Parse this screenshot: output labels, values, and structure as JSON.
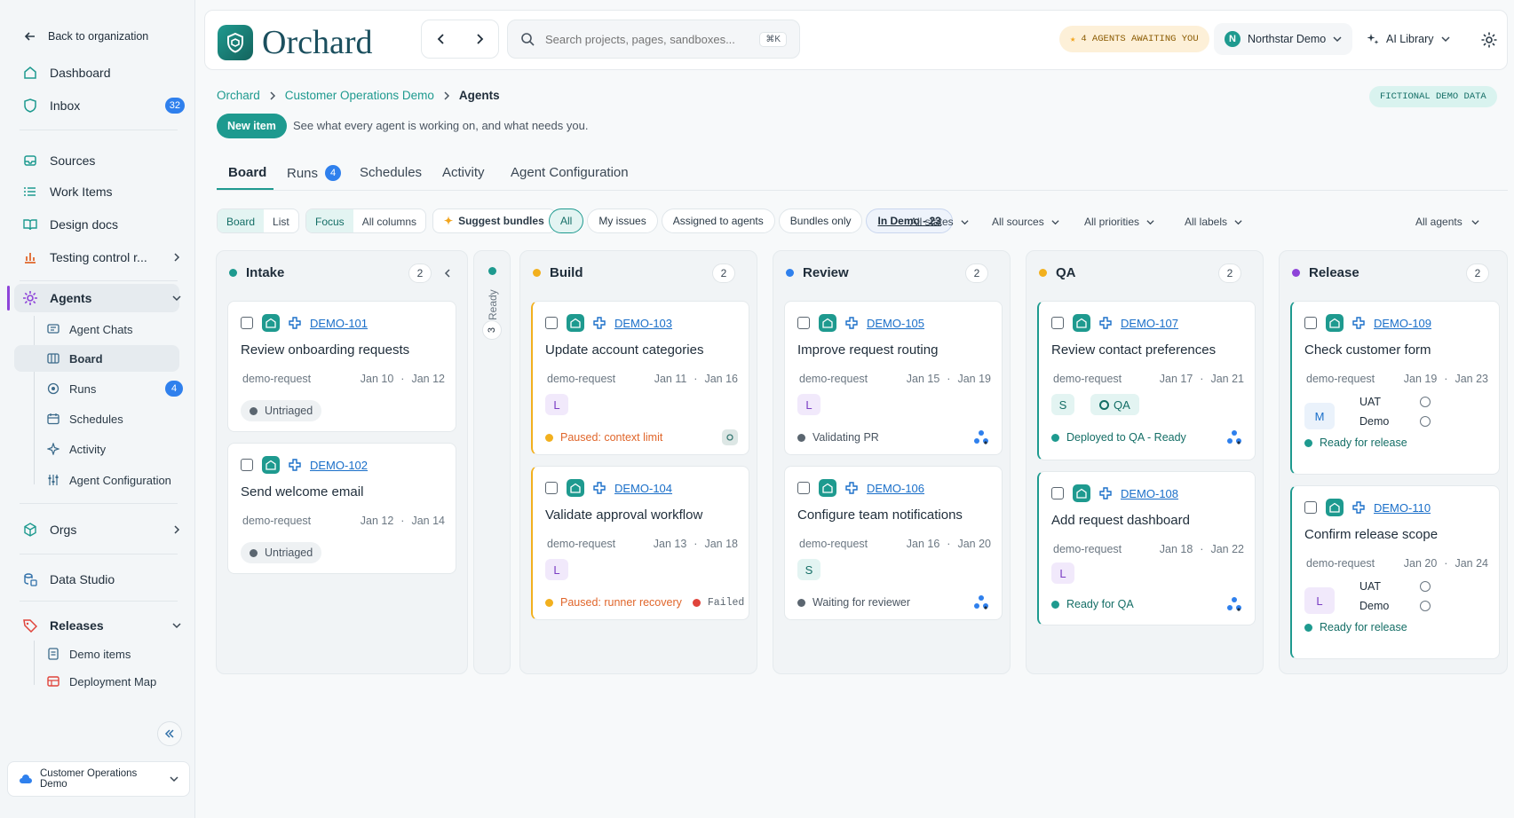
{
  "sidebar": {
    "back": "Back to organization",
    "items": {
      "dashboard": "Dashboard",
      "inbox": "Inbox",
      "inbox_count": "32",
      "sources": "Sources",
      "work_items": "Work Items",
      "design_docs": "Design docs",
      "testing": "Testing control r...",
      "agents": "Agents",
      "orgs": "Orgs",
      "data_studio": "Data Studio",
      "releases": "Releases"
    },
    "agents_sub": {
      "chats": "Agent Chats",
      "board": "Board",
      "runs": "Runs",
      "runs_count": "4",
      "schedules": "Schedules",
      "activity": "Activity",
      "config": "Agent Configuration"
    },
    "releases_sub": {
      "demo_items": "Demo items",
      "deployment_map": "Deployment Map"
    },
    "workspace": "Customer Operations Demo"
  },
  "topbar": {
    "logo": "Orchard",
    "search_placeholder": "Search projects, pages, sandboxes...",
    "search_shortcut": "⌘K",
    "agents_awaiting": "4 AGENTS AWAITING YOU",
    "org_initial": "N",
    "org_name": "Northstar Demo",
    "ai_library": "AI Library"
  },
  "breadcrumb": {
    "root": "Orchard",
    "project": "Customer Operations Demo",
    "current": "Agents"
  },
  "demo_badge": "FICTIONAL DEMO DATA",
  "new_item": "New item",
  "subtitle": "See what every agent is working on, and what needs you.",
  "tabs": {
    "board": "Board",
    "runs": "Runs",
    "runs_count": "4",
    "schedules": "Schedules",
    "activity": "Activity",
    "config": "Agent Configuration"
  },
  "filters": {
    "board": "Board",
    "list": "List",
    "focus": "Focus",
    "all_columns": "All columns",
    "suggest": "Suggest bundles",
    "all": "All",
    "my_issues": "My issues",
    "assigned": "Assigned to agents",
    "bundles": "Bundles only",
    "in_demo": "In Demo - 23",
    "states": "All states",
    "sources": "All sources",
    "priorities": "All priorities",
    "labels": "All labels",
    "agents": "All agents"
  },
  "ready_lane": {
    "label": "Ready",
    "count": "3"
  },
  "columns": [
    {
      "name": "Intake",
      "count": "2",
      "color": "#1e9a8f"
    },
    {
      "name": "Build",
      "count": "2",
      "color": "#f2b01e"
    },
    {
      "name": "Review",
      "count": "2",
      "color": "#2f80ed"
    },
    {
      "name": "QA",
      "count": "2",
      "color": "#f2b01e"
    },
    {
      "name": "Release",
      "count": "2",
      "color": "#8e44d9"
    }
  ],
  "cards": [
    {
      "id": "DEMO-101",
      "title": "Review onboarding requests",
      "label": "demo-request",
      "start": "Jan 10",
      "end": "Jan 12",
      "status": "Untriaged"
    },
    {
      "id": "DEMO-102",
      "title": "Send welcome email",
      "label": "demo-request",
      "start": "Jan 12",
      "end": "Jan 14",
      "status": "Untriaged"
    },
    {
      "id": "DEMO-103",
      "title": "Update account categories",
      "label": "demo-request",
      "start": "Jan 11",
      "end": "Jan 16",
      "avatar": "L",
      "status": "Paused: context limit"
    },
    {
      "id": "DEMO-104",
      "title": "Validate approval workflow",
      "label": "demo-request",
      "start": "Jan 13",
      "end": "Jan 18",
      "avatar": "L",
      "status": "Paused: runner recovery",
      "status2": "Failed"
    },
    {
      "id": "DEMO-105",
      "title": "Improve request routing",
      "label": "demo-request",
      "start": "Jan 15",
      "end": "Jan 19",
      "avatar": "L",
      "status": "Validating PR"
    },
    {
      "id": "DEMO-106",
      "title": "Configure team notifications",
      "label": "demo-request",
      "start": "Jan 16",
      "end": "Jan 20",
      "avatar": "S",
      "status": "Waiting for reviewer"
    },
    {
      "id": "DEMO-107",
      "title": "Review contact preferences",
      "label": "demo-request",
      "start": "Jan 17",
      "end": "Jan 21",
      "avatar": "S",
      "tag": "QA",
      "status": "Deployed to QA - Ready"
    },
    {
      "id": "DEMO-108",
      "title": "Add request dashboard",
      "label": "demo-request",
      "start": "Jan 18",
      "end": "Jan 22",
      "avatar": "L",
      "status": "Ready for QA"
    },
    {
      "id": "DEMO-109",
      "title": "Check customer form",
      "label": "demo-request",
      "start": "Jan 19",
      "end": "Jan 23",
      "avatar": "M",
      "env1": "UAT",
      "env2": "Demo",
      "status": "Ready for release"
    },
    {
      "id": "DEMO-110",
      "title": "Confirm release scope",
      "label": "demo-request",
      "start": "Jan 20",
      "end": "Jan 24",
      "avatar": "L",
      "env1": "UAT",
      "env2": "Demo",
      "status": "Ready for release"
    }
  ]
}
